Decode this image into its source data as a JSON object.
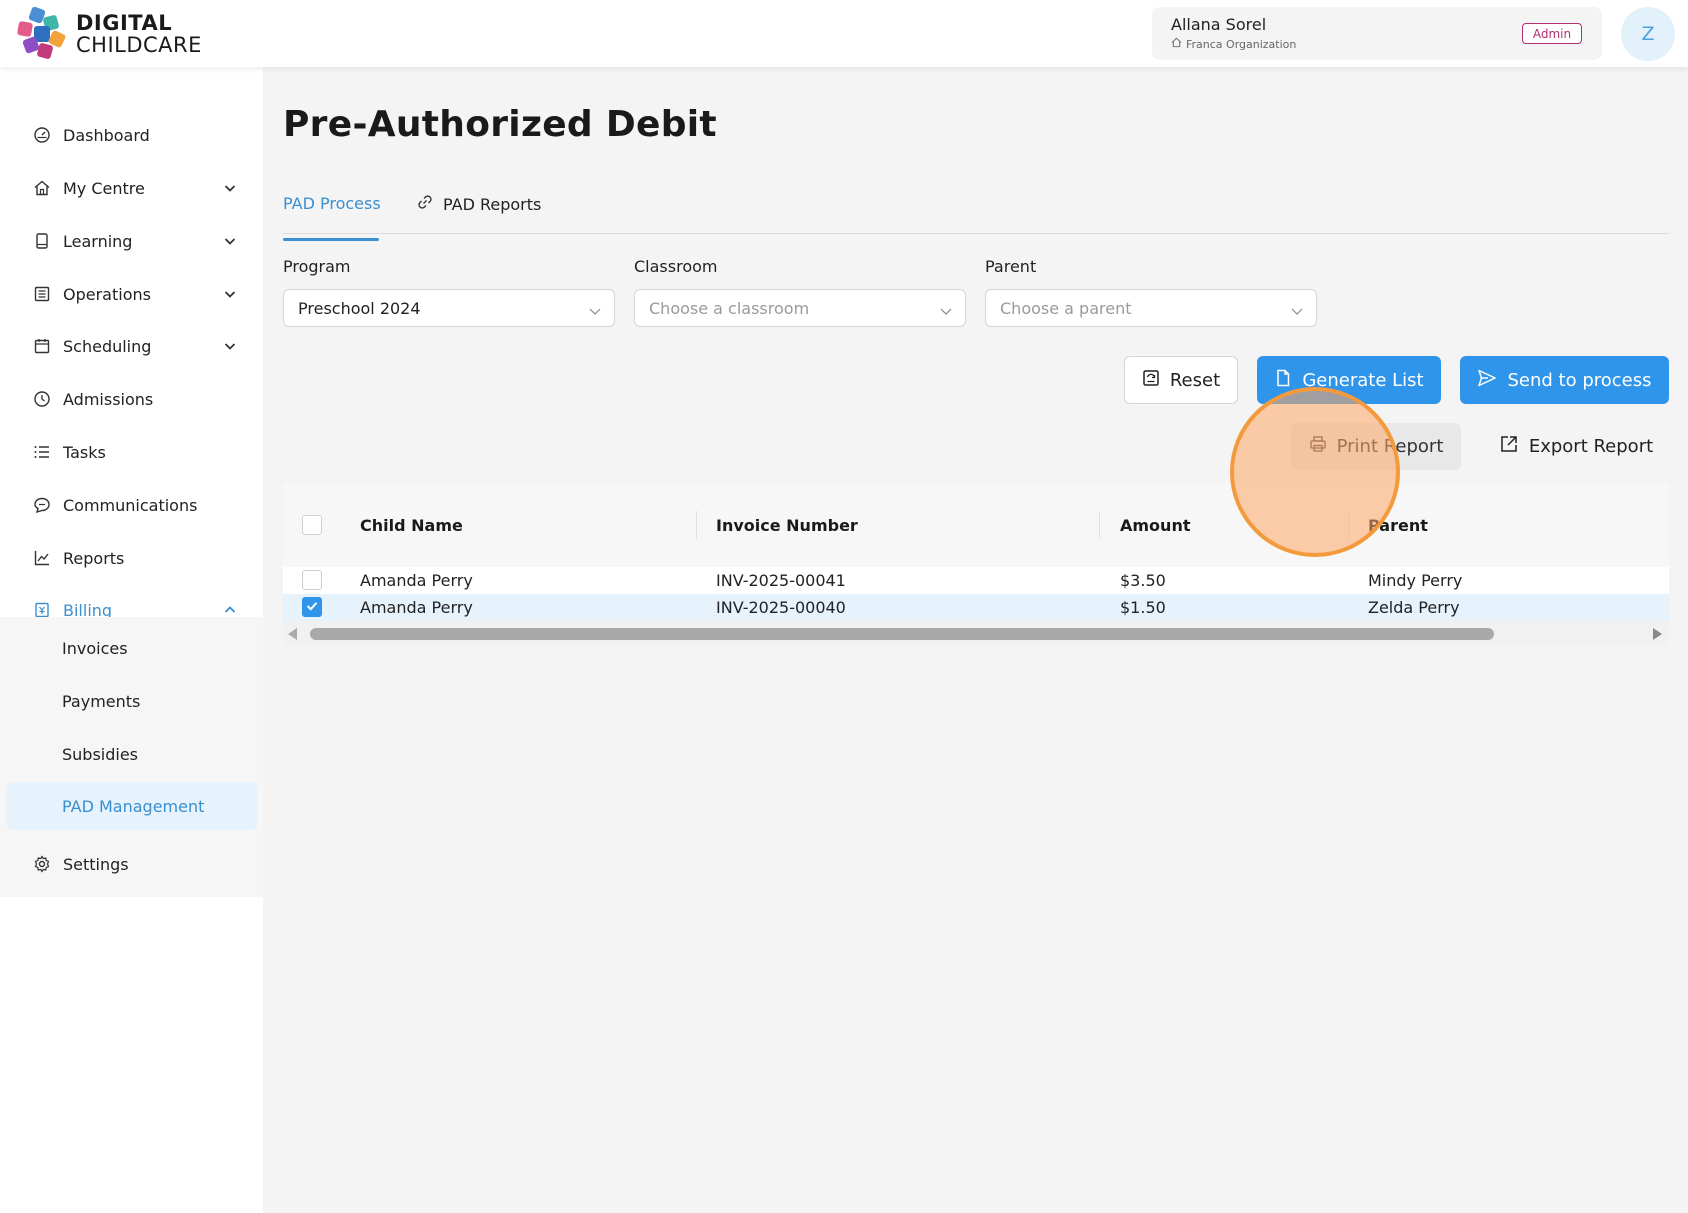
{
  "brand": {
    "line1": "DIGITAL",
    "line2": "CHILDCARE"
  },
  "user": {
    "name": "Allana Sorel",
    "org": "Franca Organization",
    "role": "Admin",
    "avatar_initial": "Z"
  },
  "sidebar": {
    "items": [
      {
        "label": "Dashboard",
        "icon": "dashboard-icon"
      },
      {
        "label": "My Centre",
        "icon": "home-icon"
      },
      {
        "label": "Learning",
        "icon": "book-icon"
      },
      {
        "label": "Operations",
        "icon": "list-icon"
      },
      {
        "label": "Scheduling",
        "icon": "calendar-icon"
      },
      {
        "label": "Admissions",
        "icon": "clock-icon"
      },
      {
        "label": "Tasks",
        "icon": "tasks-icon"
      },
      {
        "label": "Communications",
        "icon": "chat-icon"
      },
      {
        "label": "Reports",
        "icon": "chart-icon"
      },
      {
        "label": "Billing",
        "icon": "billing-icon"
      },
      {
        "label": "Settings",
        "icon": "gear-icon"
      }
    ],
    "billing_sub": [
      "Invoices",
      "Payments",
      "Subsidies",
      "PAD Management"
    ]
  },
  "page": {
    "title": "Pre-Authorized Debit"
  },
  "tabs": [
    {
      "label": "PAD Process"
    },
    {
      "label": "PAD Reports"
    }
  ],
  "filters": {
    "program": {
      "label": "Program",
      "value": "Preschool 2024"
    },
    "classroom": {
      "label": "Classroom",
      "placeholder": "Choose a classroom"
    },
    "parent": {
      "label": "Parent",
      "placeholder": "Choose a parent"
    }
  },
  "actions": {
    "reset": "Reset",
    "generate": "Generate List",
    "send": "Send to process",
    "print": "Print Report",
    "export": "Export Report"
  },
  "table": {
    "columns": [
      "Child Name",
      "Invoice Number",
      "Amount",
      "Parent"
    ],
    "rows": [
      {
        "child": "Amanda Perry",
        "invoice": "INV-2025-00041",
        "amount": "$3.50",
        "parent": "Mindy Perry",
        "checked": false
      },
      {
        "child": "Amanda Perry",
        "invoice": "INV-2025-00040",
        "amount": "$1.50",
        "parent": "Zelda Perry",
        "checked": true
      }
    ]
  },
  "colors": {
    "accent": "#2f95ea",
    "active_text": "#3a8fd0",
    "admin_badge": "#b0306e",
    "cursor": "#f39a3d"
  }
}
